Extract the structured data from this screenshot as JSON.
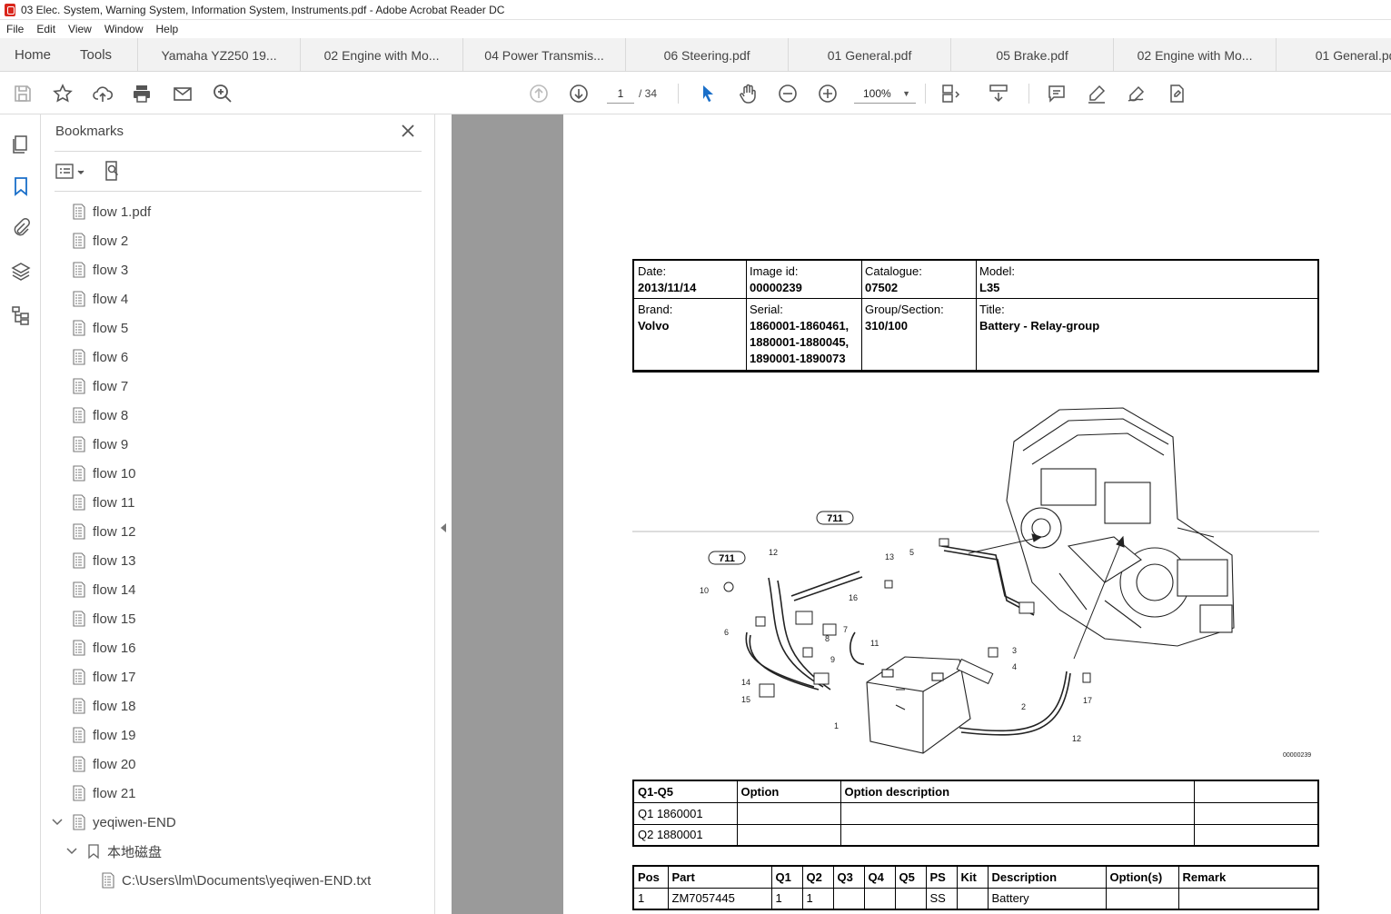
{
  "window": {
    "title": "03 Elec. System, Warning System, Information System, Instruments.pdf - Adobe Acrobat Reader DC"
  },
  "menu": [
    "File",
    "Edit",
    "View",
    "Window",
    "Help"
  ],
  "tabs": {
    "home": "Home",
    "tools": "Tools",
    "documents": [
      "Yamaha YZ250 19...",
      "02 Engine with Mo...",
      "04 Power Transmis...",
      "06 Steering.pdf",
      "01 General.pdf",
      "05 Brake.pdf",
      "02 Engine with Mo...",
      "01 General.pdf"
    ]
  },
  "toolbar": {
    "page_current": "1",
    "page_total": "/ 34",
    "zoom": "100%"
  },
  "bookmarks": {
    "header": "Bookmarks",
    "items": [
      {
        "label": "flow 1.pdf",
        "level": 0
      },
      {
        "label": "flow 2",
        "level": 0
      },
      {
        "label": "flow 3",
        "level": 0
      },
      {
        "label": "flow 4",
        "level": 0
      },
      {
        "label": "flow 5",
        "level": 0
      },
      {
        "label": "flow 6",
        "level": 0
      },
      {
        "label": "flow 7",
        "level": 0
      },
      {
        "label": "flow 8",
        "level": 0
      },
      {
        "label": "flow 9",
        "level": 0
      },
      {
        "label": "flow 10",
        "level": 0
      },
      {
        "label": "flow 11",
        "level": 0
      },
      {
        "label": "flow 12",
        "level": 0
      },
      {
        "label": "flow 13",
        "level": 0
      },
      {
        "label": "flow 14",
        "level": 0
      },
      {
        "label": "flow 15",
        "level": 0
      },
      {
        "label": "flow 16",
        "level": 0
      },
      {
        "label": "flow 17",
        "level": 0
      },
      {
        "label": "flow 18",
        "level": 0
      },
      {
        "label": "flow 19",
        "level": 0
      },
      {
        "label": "flow 20",
        "level": 0
      },
      {
        "label": "flow 21",
        "level": 0
      },
      {
        "label": "yeqiwen-END",
        "level": 0,
        "expanded": true
      },
      {
        "label": "本地磁盘",
        "level": 1,
        "expanded": true
      },
      {
        "label": "C:\\Users\\lm\\Documents\\yeqiwen-END.txt",
        "level": 2
      }
    ]
  },
  "document": {
    "header": {
      "date_label": "Date:",
      "date": "2013/11/14",
      "image_id_label": "Image id:",
      "image_id": "00000239",
      "catalogue_label": "Catalogue:",
      "catalogue": "07502",
      "model_label": "Model:",
      "model": "L35",
      "brand_label": "Brand:",
      "brand": "Volvo",
      "serial_label": "Serial:",
      "serial_1": "1860001-1860461,",
      "serial_2": "1880001-1880045,",
      "serial_3": "1890001-1890073",
      "group_label": "Group/Section:",
      "group": "310/100",
      "title_label": "Title:",
      "title": "Battery - Relay-group"
    },
    "diagram": {
      "callouts": [
        "711",
        "711"
      ],
      "numbers": [
        "12",
        "13",
        "5",
        "10",
        "16",
        "6",
        "7",
        "8",
        "9",
        "11",
        "3",
        "4",
        "14",
        "15",
        "1",
        "2",
        "17",
        "12"
      ],
      "image_code": "00000239"
    },
    "option_table": {
      "headers": [
        "Q1-Q5",
        "Option",
        "Option description",
        ""
      ],
      "rows": [
        [
          "Q1 1860001",
          "",
          "",
          ""
        ],
        [
          "Q2 1880001",
          "",
          "",
          ""
        ]
      ]
    },
    "parts_table": {
      "headers": [
        "Pos",
        "Part",
        "Q1",
        "Q2",
        "Q3",
        "Q4",
        "Q5",
        "PS",
        "Kit",
        "Description",
        "Option(s)",
        "Remark"
      ],
      "rows": [
        [
          "1",
          "ZM7057445",
          "1",
          "1",
          "",
          "",
          "",
          "SS",
          "",
          "Battery",
          "",
          ""
        ]
      ]
    }
  }
}
